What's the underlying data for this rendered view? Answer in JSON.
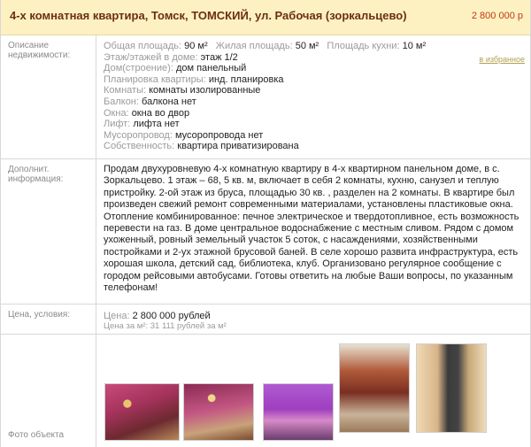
{
  "header": {
    "title": "4-х комнатная квартира, Томск, ТОМСКИЙ, ул. Рабочая (зоркальцево)",
    "price": "2 800 000 р"
  },
  "specs": {
    "label": "Описание недвижимости:",
    "favorite_link": "в избранное",
    "total_area": {
      "key": "Общая площадь:",
      "value": "90 м²"
    },
    "living_area": {
      "key": "Жилая площадь:",
      "value": "50 м²"
    },
    "kitchen_area": {
      "key": "Площадь кухни:",
      "value": "10 м²"
    },
    "lines": [
      {
        "key": "Этаж/этажей в доме:",
        "value": "этаж 1/2"
      },
      {
        "key": "Дом(строение):",
        "value": "дом панельный"
      },
      {
        "key": "Планировка квартиры:",
        "value": "инд. планировка"
      },
      {
        "key": "Комнаты:",
        "value": "комнаты изолированные"
      },
      {
        "key": "Балкон:",
        "value": "балкона нет"
      },
      {
        "key": "Окна:",
        "value": "окна во двор"
      },
      {
        "key": "Лифт:",
        "value": "лифта нет"
      },
      {
        "key": "Мусоропровод:",
        "value": "мусоропровода нет"
      },
      {
        "key": "Собственность:",
        "value": "квартира приватизирована"
      }
    ]
  },
  "info": {
    "label": "Дополнит. информация:",
    "text": "Продам двухуровневую 4-х комнатную квартиру в 4-х квартирном панельном доме, в с. Зоркальцево. 1 этаж – 68, 5 кв. м, включает в себя 2 комнаты, кухню, санузел и теплую пристройку. 2-ой этаж из бруса, площадью 30 кв. , разделен на 2 комнаты. В квартире был произведен свежий ремонт современными материалами, установлены пластиковые окна. Отопление комбинированное: печное электрическое и твердотопливное, есть возможность перевести на газ. В доме центральное водоснабжение с местным сливом. Рядом с домом ухоженный, ровный земельный участок 5 соток, с насаждениями, хозяйственными постройками и 2-ух этажной брусовой баней. В селе хорошо развита инфраструктура, есть хорошая школа, детский сад, библиотека, клуб. Организовано регулярное сообщение с городом рейсовыми автобусами. Готовы ответить на любые Ваши вопросы, по указанным телефонам!"
  },
  "price_block": {
    "label": "Цена, условия:",
    "price_key": "Цена:",
    "price_value": "2 800 000 рублей",
    "per_m2_key": "Цена за м²:",
    "per_m2_value": "31 111 рублей за м²"
  },
  "photos": {
    "label": "Фото объекта",
    "count_shown": 5
  },
  "colors": {
    "header_bg": "#fdf1c2",
    "title_color": "#6b2f12",
    "price_color": "#c03a10",
    "muted_label": "#8a8a8a"
  }
}
